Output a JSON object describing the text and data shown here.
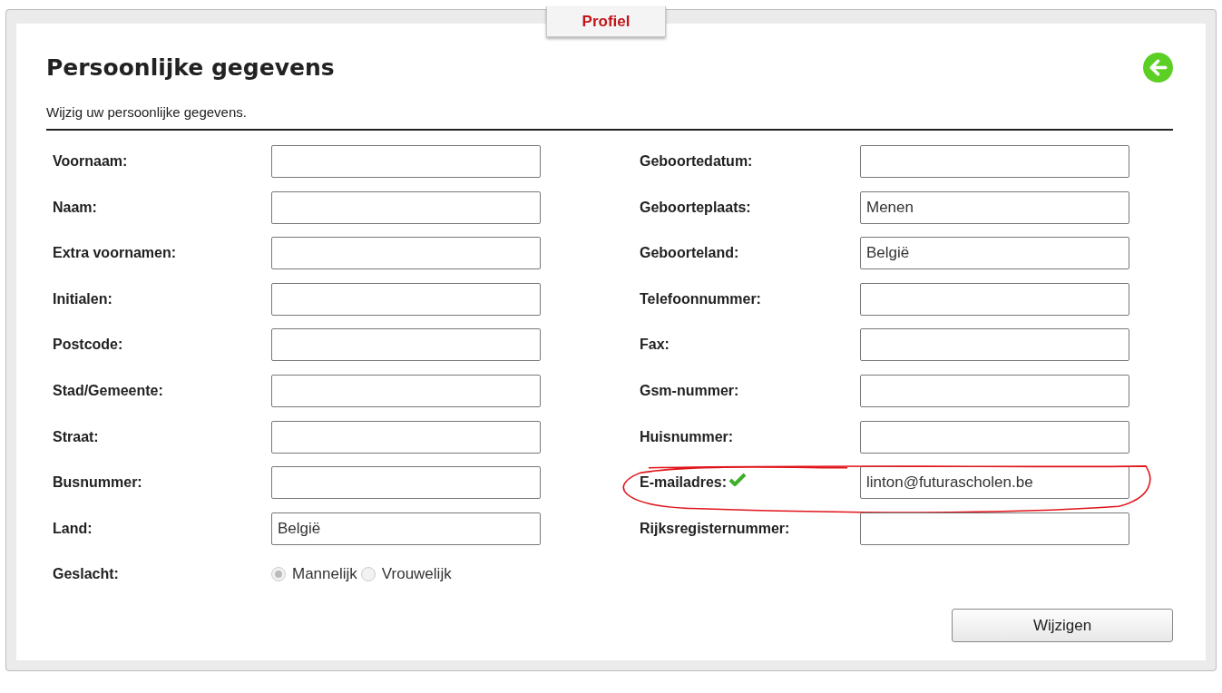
{
  "tab": {
    "label": "Profiel"
  },
  "header": {
    "title": "Persoonlijke gegevens",
    "subtitle": "Wijzig uw persoonlijke gegevens."
  },
  "left_fields": [
    {
      "label": "Voornaam:"
    },
    {
      "label": "Naam:"
    },
    {
      "label": "Extra voornamen:"
    },
    {
      "label": "Initialen:"
    },
    {
      "label": "Postcode:"
    },
    {
      "label": "Stad/Gemeente:"
    },
    {
      "label": "Straat:"
    },
    {
      "label": "Busnummer:"
    },
    {
      "label": "Land:",
      "value": "België"
    }
  ],
  "gender": {
    "label": "Geslacht:",
    "disabled": true,
    "options": [
      {
        "label": "Mannelijk",
        "selected": true
      },
      {
        "label": "Vrouwelijk",
        "selected": false
      }
    ]
  },
  "right_fields": [
    {
      "label": "Geboortedatum:"
    },
    {
      "label": "Geboorteplaats:",
      "value": "Menen"
    },
    {
      "label": "Geboorteland:",
      "value": "België"
    },
    {
      "label": "Telefoonnummer:"
    },
    {
      "label": "Fax:"
    },
    {
      "label": "Gsm-nummer:"
    },
    {
      "label": "Huisnummer:"
    },
    {
      "label": "E-mailadres:",
      "value": "linton@futurascholen.be",
      "verified": true,
      "annotated": true
    },
    {
      "label": "Rijksregisternummer:"
    }
  ],
  "buttons": [
    {
      "label": "Wijzigen"
    }
  ]
}
